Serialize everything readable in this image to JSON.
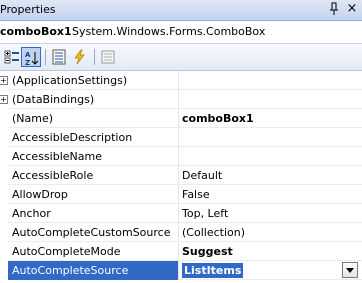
{
  "window": {
    "title": "Properties",
    "close_glyph": "×"
  },
  "object_selector": {
    "name": "comboBox1",
    "type": "System.Windows.Forms.ComboBox"
  },
  "toolbar": {
    "buttons": [
      {
        "icon": "categorized-icon"
      },
      {
        "icon": "alphabetical-icon",
        "active": true
      },
      {
        "icon": "properties-icon"
      },
      {
        "icon": "events-icon"
      },
      {
        "icon": "property-pages-icon"
      }
    ]
  },
  "properties": [
    {
      "name": "(ApplicationSettings)",
      "value": "",
      "expandable": true,
      "expand_glyph": "+"
    },
    {
      "name": "(DataBindings)",
      "value": "",
      "expandable": true,
      "expand_glyph": "+"
    },
    {
      "name": "(Name)",
      "value": "comboBox1",
      "bold": true
    },
    {
      "name": "AccessibleDescription",
      "value": ""
    },
    {
      "name": "AccessibleName",
      "value": ""
    },
    {
      "name": "AccessibleRole",
      "value": "Default"
    },
    {
      "name": "AllowDrop",
      "value": "False"
    },
    {
      "name": "Anchor",
      "value": "Top, Left"
    },
    {
      "name": "AutoCompleteCustomSource",
      "value": "(Collection)"
    },
    {
      "name": "AutoCompleteMode",
      "value": "Suggest",
      "bold": true
    },
    {
      "name": "AutoCompleteSource",
      "value": "ListItems",
      "bold": true,
      "selected": true
    }
  ],
  "colors": {
    "selection": "#3169c6",
    "title_gradient_top": "#dfe7f6",
    "title_gradient_bottom": "#c3d3ef"
  }
}
